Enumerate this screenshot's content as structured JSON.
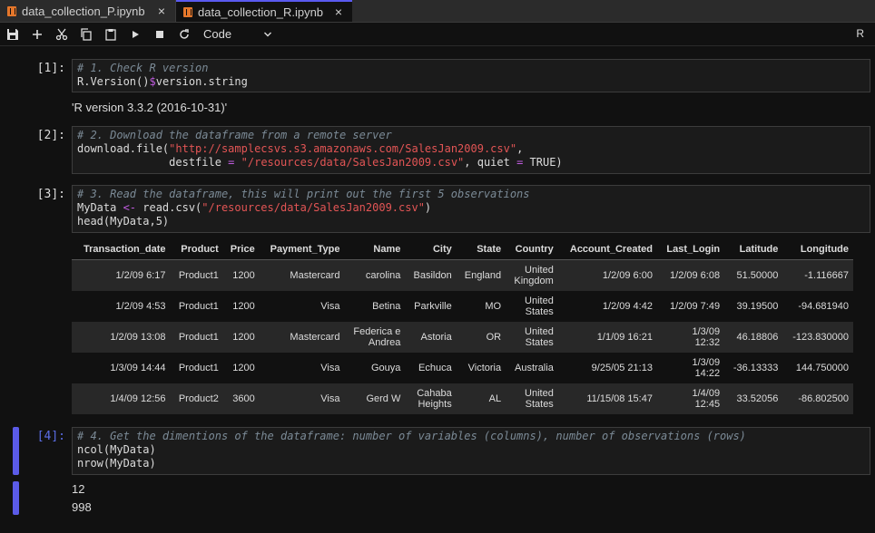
{
  "tabs": [
    {
      "label": "data_collection_P.ipynb",
      "close": "×"
    },
    {
      "label": "data_collection_R.ipynb",
      "close": "×"
    }
  ],
  "toolbar": {
    "icons": [
      "save-icon",
      "add-icon",
      "cut-icon",
      "copy-icon",
      "paste-icon",
      "run-icon",
      "stop-icon",
      "restart-icon"
    ],
    "cell_type": "Code",
    "kernel": "R"
  },
  "cells": [
    {
      "prompt": "[1]:",
      "code_line1_comment": "# 1. Check R version",
      "code_line2_a": "R.Version()",
      "code_line2_op": "$",
      "code_line2_b": "version.string",
      "output": "'R version 3.3.2 (2016-10-31)'"
    },
    {
      "prompt": "[2]:",
      "code_line1_comment": "# 2. Download the dataframe from a remote server",
      "code_line2_a": "download.file(",
      "code_line2_str": "\"http://samplecsvs.s3.amazonaws.com/SalesJan2009.csv\"",
      "code_line2_b": ",",
      "code_line3_a": "              destfile ",
      "code_line3_op1": "=",
      "code_line3_str": "\"/resources/data/SalesJan2009.csv\"",
      "code_line3_b": ", quiet ",
      "code_line3_op2": "=",
      "code_line3_c": " TRUE)"
    },
    {
      "prompt": "[3]:",
      "code_line1_comment": "# 3. Read the dataframe, this will print out the first 5 observations",
      "code_line2_a": "MyData ",
      "code_line2_op": "<-",
      "code_line2_b": " read.csv(",
      "code_line2_str": "\"/resources/data/SalesJan2009.csv\"",
      "code_line2_c": ")",
      "code_line3": "head(MyData,5)"
    },
    {
      "prompt": "[4]:",
      "code_line1_comment": "# 4. Get the dimentions of the dataframe: number of variables (columns), number of observations (rows)",
      "code_line2": "ncol(MyData)",
      "code_line3": "nrow(MyData)",
      "output1": "12",
      "output2": "998"
    }
  ],
  "table": {
    "headers": [
      "Transaction_date",
      "Product",
      "Price",
      "Payment_Type",
      "Name",
      "City",
      "State",
      "Country",
      "Account_Created",
      "Last_Login",
      "Latitude",
      "Longitude"
    ],
    "rows": [
      [
        [
          "1/2/09 6:17"
        ],
        [
          "Product1"
        ],
        [
          "1200"
        ],
        [
          "Mastercard"
        ],
        [
          "carolina"
        ],
        [
          "Basildon"
        ],
        [
          "England"
        ],
        [
          "United",
          "Kingdom"
        ],
        [
          "1/2/09 6:00"
        ],
        [
          "1/2/09 6:08"
        ],
        [
          "51.50000"
        ],
        [
          "-1.116667"
        ]
      ],
      [
        [
          "1/2/09 4:53"
        ],
        [
          "Product1"
        ],
        [
          "1200"
        ],
        [
          "Visa"
        ],
        [
          "Betina"
        ],
        [
          "Parkville"
        ],
        [
          "MO"
        ],
        [
          "United",
          "States"
        ],
        [
          "1/2/09 4:42"
        ],
        [
          "1/2/09 7:49"
        ],
        [
          "39.19500"
        ],
        [
          "-94.681940"
        ]
      ],
      [
        [
          "1/2/09 13:08"
        ],
        [
          "Product1"
        ],
        [
          "1200"
        ],
        [
          "Mastercard"
        ],
        [
          "Federica e",
          "Andrea"
        ],
        [
          "Astoria"
        ],
        [
          "OR"
        ],
        [
          "United",
          "States"
        ],
        [
          "1/1/09 16:21"
        ],
        [
          "1/3/09",
          "12:32"
        ],
        [
          "46.18806"
        ],
        [
          "-123.830000"
        ]
      ],
      [
        [
          "1/3/09 14:44"
        ],
        [
          "Product1"
        ],
        [
          "1200"
        ],
        [
          "Visa"
        ],
        [
          "Gouya"
        ],
        [
          "Echuca"
        ],
        [
          "Victoria"
        ],
        [
          "Australia"
        ],
        [
          "9/25/05 21:13"
        ],
        [
          "1/3/09",
          "14:22"
        ],
        [
          "-36.13333"
        ],
        [
          "144.750000"
        ]
      ],
      [
        [
          "1/4/09 12:56"
        ],
        [
          "Product2"
        ],
        [
          "3600"
        ],
        [
          "Visa"
        ],
        [
          "Gerd W"
        ],
        [
          "Cahaba",
          "Heights"
        ],
        [
          "AL"
        ],
        [
          "United",
          "States"
        ],
        [
          "11/15/08 15:47"
        ],
        [
          "1/4/09",
          "12:45"
        ],
        [
          "33.52056"
        ],
        [
          "-86.802500"
        ]
      ]
    ]
  }
}
